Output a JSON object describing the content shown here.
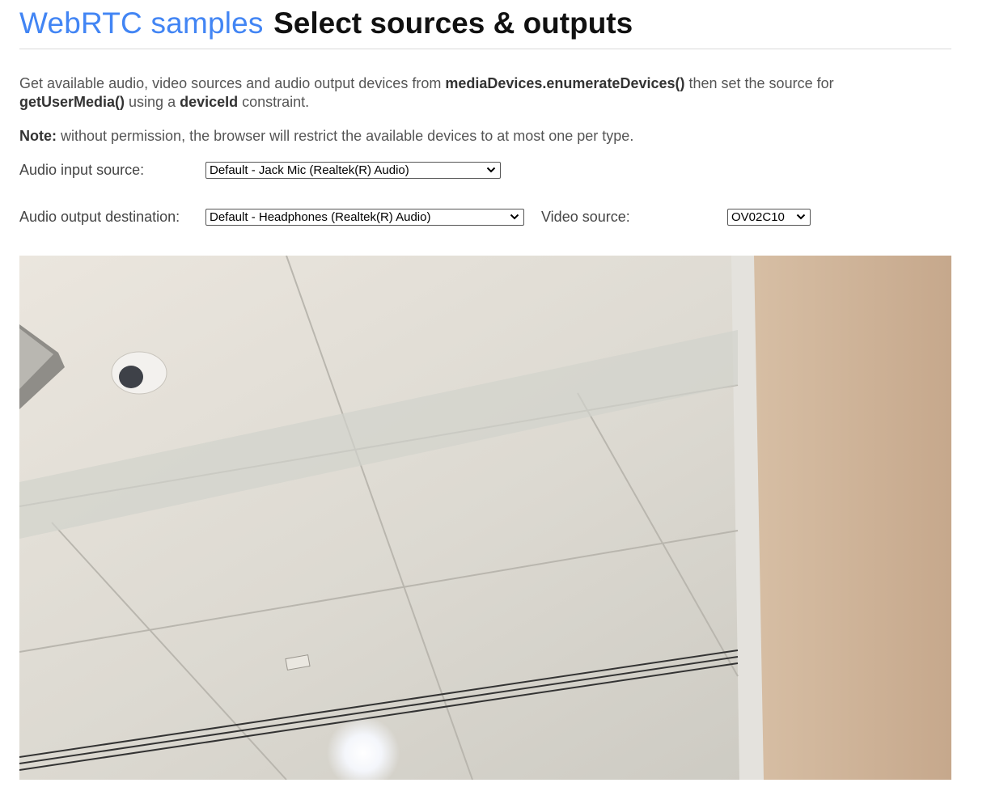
{
  "header": {
    "samples_link": "WebRTC samples",
    "title": "Select sources & outputs"
  },
  "description": {
    "p1_text_1": "Get available audio, video sources and audio output devices from ",
    "p1_code_1": "mediaDevices.enumerateDevices()",
    "p1_text_2": " then set the source for ",
    "p1_code_2": "getUserMedia()",
    "p1_text_3": " using a ",
    "p1_code_3": "deviceId",
    "p1_text_4": " constraint."
  },
  "note": {
    "label": "Note:",
    "text": " without permission, the browser will restrict the available devices to at most one per type."
  },
  "controls": {
    "audio_input": {
      "label": "Audio input source:",
      "selected": "Default - Jack Mic (Realtek(R) Audio)"
    },
    "audio_output": {
      "label": "Audio output destination:",
      "selected": "Default - Headphones (Realtek(R) Audio)"
    },
    "video_source": {
      "label": "Video source:",
      "selected": "OV02C10"
    }
  },
  "colors": {
    "link": "#4285f4",
    "title": "#111111",
    "body_text": "#555555"
  },
  "icons": {
    "select_arrow": "chevron-down-icon"
  }
}
